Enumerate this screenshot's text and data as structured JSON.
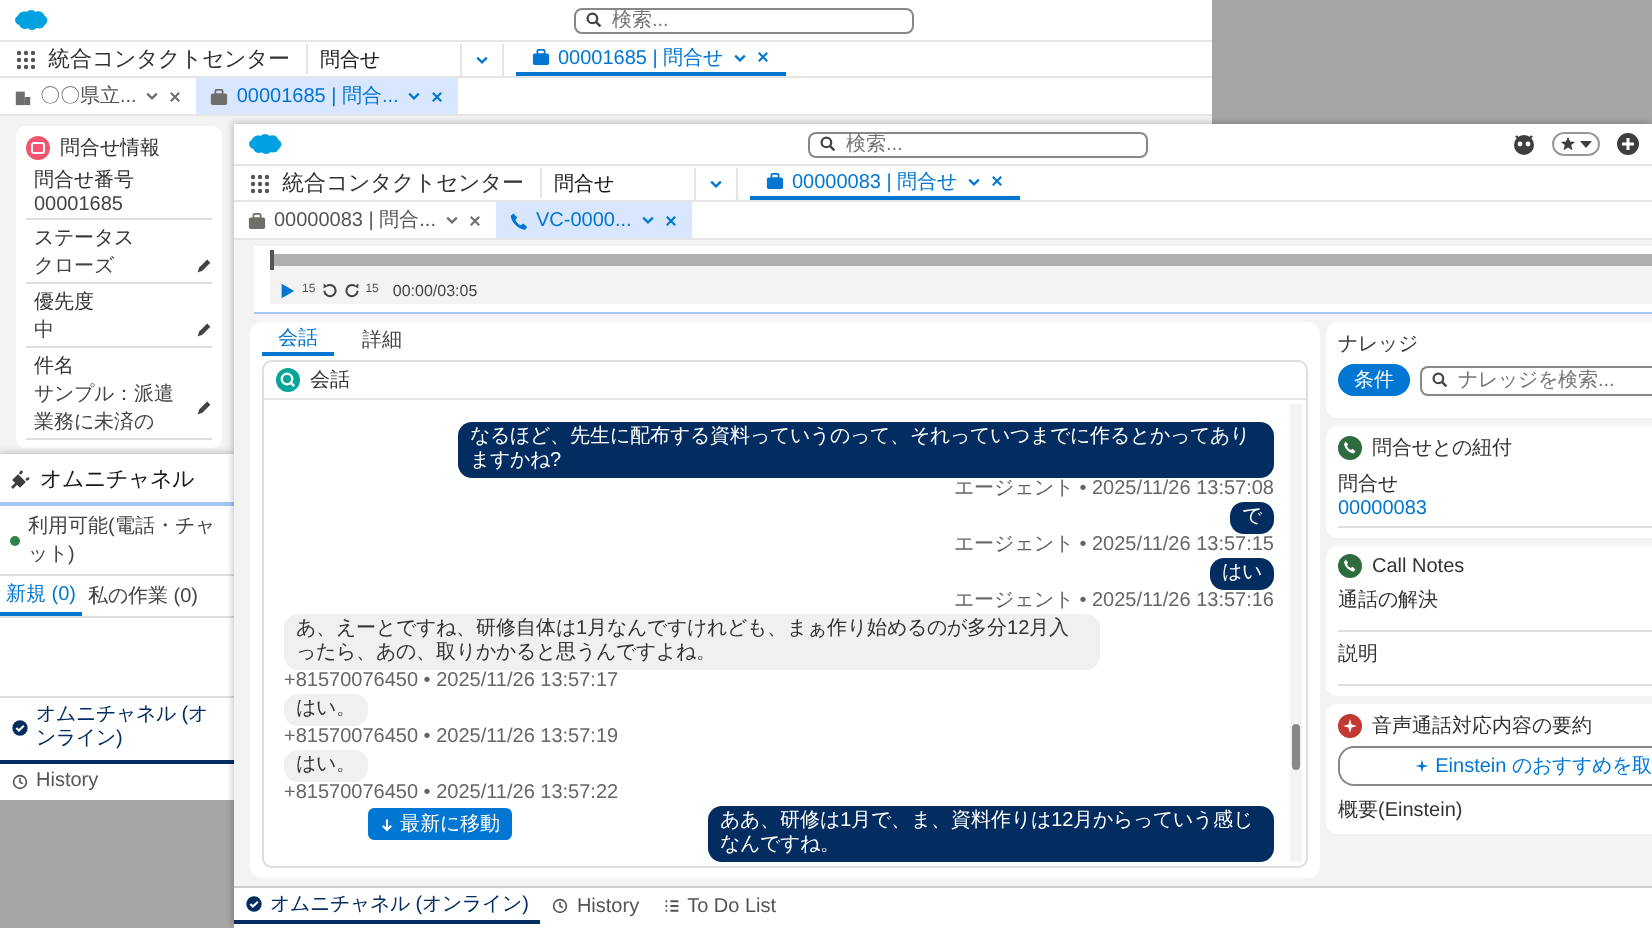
{
  "back_window": {
    "search": {
      "placeholder": "検索..."
    },
    "app_name": "統合コンタクトセンター",
    "nav_object": "問合せ",
    "workspace_tabs": [
      {
        "label": "00001685 | 問合せ",
        "selected": true
      }
    ],
    "subtabs": [
      {
        "label": "〇〇県立...",
        "kind": "account",
        "selected": false
      },
      {
        "label": "00001685 | 問合...",
        "kind": "case",
        "selected": true
      }
    ],
    "record_card": {
      "title": "問合せ情報",
      "fields": [
        {
          "label": "問合せ番号",
          "value": "00001685",
          "editable": false
        },
        {
          "label": "ステータス",
          "value": "クローズ",
          "editable": true
        },
        {
          "label": "優先度",
          "value": "中",
          "editable": true
        },
        {
          "label": "件名",
          "value": "サンプル：派遣業務に未済の",
          "editable": true
        }
      ]
    },
    "omni_channel": {
      "title": "オムニチャネル",
      "status": "利用可能(電話・チャット)",
      "tabs": [
        {
          "label": "新規 (0)",
          "selected": true
        },
        {
          "label": "私の作業 (0)",
          "selected": false
        }
      ]
    },
    "utility_bar": [
      {
        "label": "オムニチャネル (オンライン)",
        "kind": "omni",
        "selected": true
      },
      {
        "label": "History",
        "kind": "history",
        "selected": false
      }
    ]
  },
  "front_window": {
    "search": {
      "placeholder": "検索..."
    },
    "app_name": "統合コンタクトセンター",
    "nav_object": "問合せ",
    "workspace_tabs": [
      {
        "label": "00000083 | 問合せ",
        "selected": true
      }
    ],
    "subtabs": [
      {
        "label": "00000083 | 問合...",
        "kind": "case",
        "selected": false
      },
      {
        "label": "VC-0000...",
        "kind": "call",
        "selected": true
      }
    ],
    "player": {
      "level": 0,
      "rewind_label": "15",
      "forward_label": "15",
      "time": "00:00/03:05"
    },
    "tabs": [
      {
        "label": "会話",
        "selected": true
      },
      {
        "label": "詳細",
        "selected": false
      }
    ],
    "conversation": {
      "title": "会話",
      "jump_button": "最新に移動",
      "messages": [
        {
          "kind": "agent",
          "text": "なるほど、先生に配布する資料っていうのって、それっていつまでに作るとかってありますかね?",
          "meta": "エージェント • 2025/11/26 13:57:08"
        },
        {
          "kind": "agent",
          "text": "で",
          "meta": "エージェント • 2025/11/26 13:57:15"
        },
        {
          "kind": "agent",
          "text": "はい",
          "meta": "エージェント • 2025/11/26 13:57:16"
        },
        {
          "kind": "customer",
          "text": "あ、えーとですね、研修自体は1月なんですけれども、まぁ作り始めるのが多分12月入ったら、あの、取りかかると思うんですよね。",
          "meta": "+81570076450 • 2025/11/26 13:57:17"
        },
        {
          "kind": "customer",
          "text": "はい。",
          "meta": "+81570076450 • 2025/11/26 13:57:19"
        },
        {
          "kind": "customer",
          "text": "はい。",
          "meta": "+81570076450 • 2025/11/26 13:57:22"
        },
        {
          "kind": "agent",
          "text": "ああ、研修は1月で、ま、資料作りは12月からっていう感じなんですね。"
        }
      ]
    },
    "knowledge": {
      "title": "ナレッジ",
      "filter_button": "条件",
      "search_placeholder": "ナレッジを検索..."
    },
    "related_case": {
      "title": "問合せとの紐付",
      "field_label": "問合せ",
      "field_link": "00000083"
    },
    "call_notes": {
      "title": "Call Notes",
      "fields": [
        "通話の解決",
        "説明"
      ]
    },
    "summary": {
      "title": "音声通話対応内容の要約",
      "einstein_button": "Einstein のおすすめを取",
      "field_label": "概要(Einstein)"
    },
    "utility_bar": [
      {
        "label": "オムニチャネル (オンライン)",
        "kind": "omni",
        "selected": true
      },
      {
        "label": "History",
        "kind": "history",
        "selected": false
      },
      {
        "label": "To Do List",
        "kind": "todo",
        "selected": false
      }
    ]
  }
}
